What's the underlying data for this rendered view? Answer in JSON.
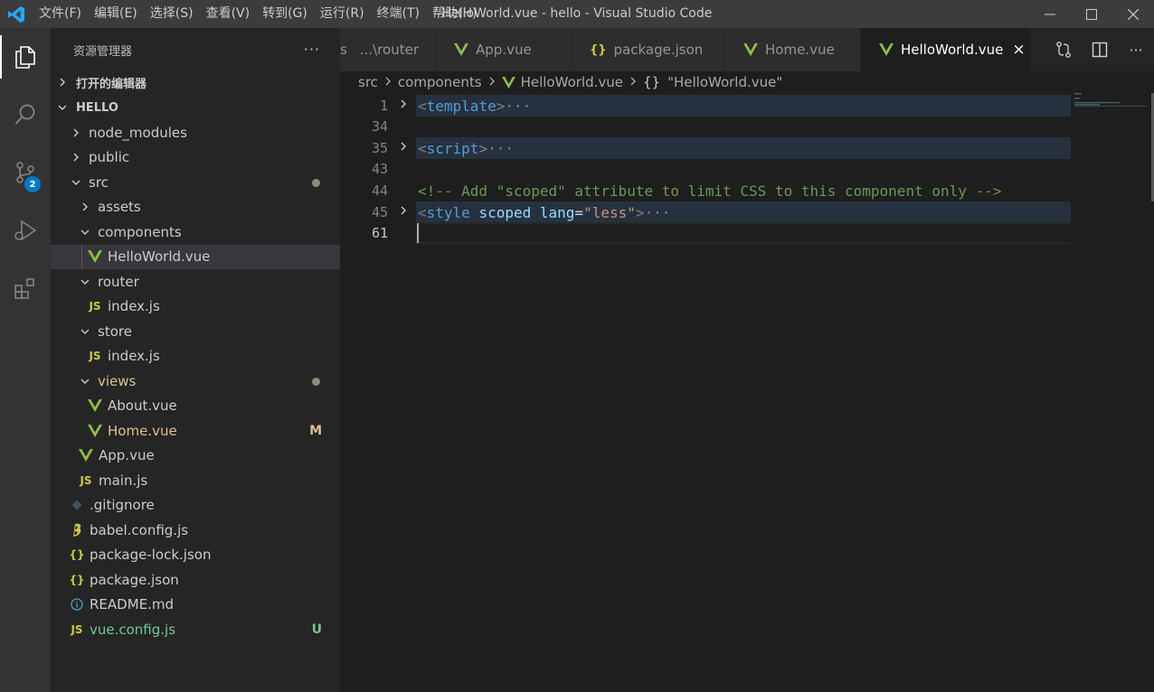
{
  "titlebar": {
    "menu": [
      "文件(F)",
      "编辑(E)",
      "选择(S)",
      "查看(V)",
      "转到(G)",
      "运行(R)",
      "终端(T)",
      "帮助(H)"
    ],
    "title": "HelloWorld.vue - hello - Visual Studio Code"
  },
  "activity": {
    "scm_badge": "2"
  },
  "sidebar": {
    "title": "资源管理器",
    "more": "···",
    "open_editors": "打开的编辑器",
    "project": "HELLO",
    "tree": [
      {
        "label": "node_modules",
        "type": "folder",
        "expanded": false
      },
      {
        "label": "public",
        "type": "folder",
        "expanded": false
      },
      {
        "label": "src",
        "type": "folder",
        "expanded": true
      },
      {
        "label": "assets",
        "type": "folder",
        "expanded": false
      },
      {
        "label": "components",
        "type": "folder",
        "expanded": true
      },
      {
        "label": "HelloWorld.vue",
        "type": "vue"
      },
      {
        "label": "router",
        "type": "folder",
        "expanded": true
      },
      {
        "label": "index.js",
        "type": "js"
      },
      {
        "label": "store",
        "type": "folder",
        "expanded": true
      },
      {
        "label": "index.js",
        "type": "js"
      },
      {
        "label": "views",
        "type": "folder",
        "expanded": true
      },
      {
        "label": "About.vue",
        "type": "vue"
      },
      {
        "label": "Home.vue",
        "type": "vue",
        "deco": "M"
      },
      {
        "label": "App.vue",
        "type": "vue"
      },
      {
        "label": "main.js",
        "type": "js"
      },
      {
        "label": ".gitignore",
        "type": "git"
      },
      {
        "label": "babel.config.js",
        "type": "babel"
      },
      {
        "label": "package-lock.json",
        "type": "json"
      },
      {
        "label": "package.json",
        "type": "json"
      },
      {
        "label": "README.md",
        "type": "info"
      },
      {
        "label": "vue.config.js",
        "type": "js",
        "deco": "U"
      }
    ],
    "js_icon": "JS",
    "json_icon": "{}"
  },
  "tabs": [
    {
      "label": "...\\router",
      "prefix": "s",
      "icon": "none"
    },
    {
      "label": "App.vue",
      "icon": "vue"
    },
    {
      "label": "package.json",
      "icon": "json"
    },
    {
      "label": "Home.vue",
      "icon": "vue"
    },
    {
      "label": "HelloWorld.vue",
      "icon": "vue",
      "active": true
    }
  ],
  "tab_close": "×",
  "breadcrumb": [
    "src",
    "components",
    "HelloWorld.vue",
    "\"HelloWorld.vue\""
  ],
  "breadcrumb_obj_icon": "{}",
  "editor": {
    "line_numbers": [
      "1",
      "34",
      "35",
      "43",
      "44",
      "45",
      "61"
    ],
    "l1_open": "<",
    "l1_tag": "template",
    "l1_close": ">",
    "l35_open": "<",
    "l35_tag": "script",
    "l35_close": ">",
    "l44_comment": "<!-- Add \"scoped\" attribute to limit CSS to this component only -->",
    "l45_open": "<",
    "l45_tag": "style",
    "l45_attr1": "scoped",
    "l45_attr2": "lang",
    "l45_eq": "=",
    "l45_val": "\"less\"",
    "l45_close": ">",
    "fold_ellipsis": "···"
  }
}
